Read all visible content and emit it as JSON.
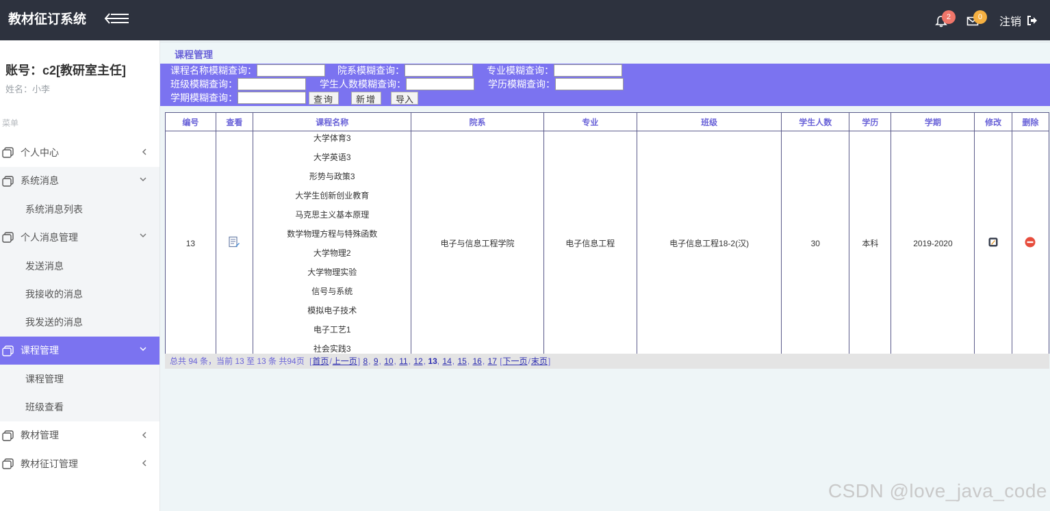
{
  "header": {
    "brand": "教材征订系统",
    "notification_count": "2",
    "message_count": "0",
    "logout_label": "注销"
  },
  "sidebar": {
    "account": "账号：c2[教研室主任]",
    "username": "姓名：小李",
    "menu_title": "菜单",
    "items": [
      {
        "label": "个人中心",
        "arrow": "left"
      },
      {
        "label": "系统消息",
        "arrow": "down",
        "sub": [
          "系统消息列表"
        ]
      },
      {
        "label": "个人消息管理",
        "arrow": "down",
        "sub": [
          "发送消息",
          "我接收的消息",
          "我发送的消息"
        ]
      },
      {
        "label": "课程管理",
        "arrow": "down",
        "active": true,
        "sub": [
          "课程管理",
          "班级查看"
        ]
      },
      {
        "label": "教材管理",
        "arrow": "left"
      },
      {
        "label": "教材征订管理",
        "arrow": "left"
      }
    ]
  },
  "page": {
    "title": "课程管理"
  },
  "search": {
    "course_name_label": "课程名称模糊查询：",
    "department_label": "院系模糊查询：",
    "major_label": "专业模糊查询：",
    "class_label": "班级模糊查询：",
    "student_count_label": "学生人数模糊查询：",
    "education_label": "学历模糊查询：",
    "semester_label": "学期模糊查询：",
    "query_btn": "查询",
    "add_btn": "新增",
    "import_btn": "导入"
  },
  "table": {
    "headers": [
      "编号",
      "查看",
      "课程名称",
      "院系",
      "专业",
      "班级",
      "学生人数",
      "学历",
      "学期",
      "修改",
      "删除"
    ],
    "row": {
      "id": "13",
      "courses": [
        "大学体育3",
        "大学英语3",
        "形势与政策3",
        "大学生创新创业教育",
        "马克思主义基本原理",
        "数学物理方程与特殊函数",
        "大学物理2",
        "大学物理实验",
        "信号与系统",
        "模拟电子技术",
        "电子工艺1",
        "社会实践3"
      ],
      "department": "电子与信息工程学院",
      "major": "电子信息工程",
      "class": "电子信息工程18-2(汉)",
      "student_count": "30",
      "education": "本科",
      "semester": "2019-2020"
    }
  },
  "pager": {
    "summary": "总共 94 条，当前 13 至 13 条 共94页",
    "first": "首页",
    "prev": "上一页",
    "pages": [
      "8",
      "9",
      "10",
      "11",
      "12",
      "13",
      "14",
      "15",
      "16",
      "17"
    ],
    "current": "13",
    "next": "下一页",
    "last": "末页"
  },
  "watermark": "CSDN @love_java_code",
  "colors": {
    "header_bg": "#2d323e",
    "accent": "#7b73f0",
    "badge_red": "#f0766a",
    "badge_yellow": "#f5b041",
    "delete_red": "#e74c3c"
  }
}
